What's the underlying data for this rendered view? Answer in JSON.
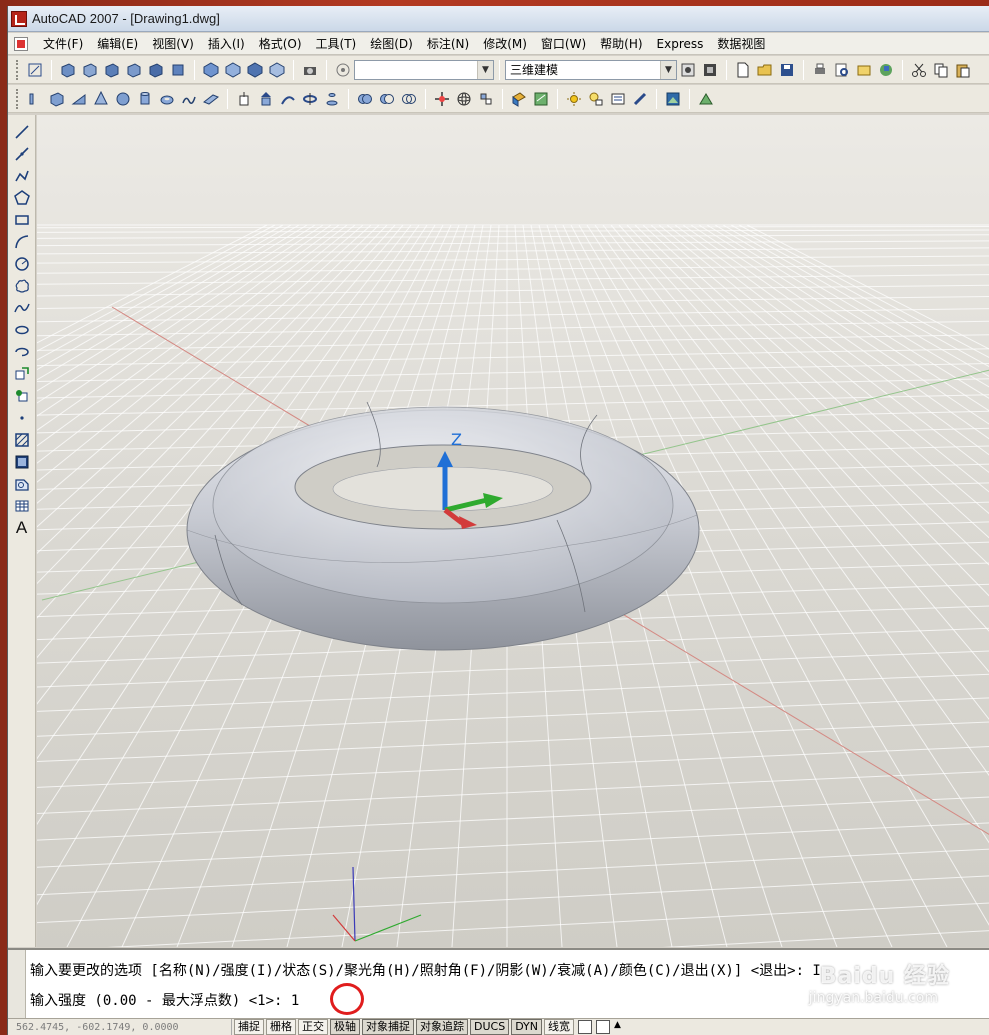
{
  "window": {
    "title": "AutoCAD 2007 - [Drawing1.dwg]"
  },
  "menubar": {
    "items": [
      "文件(F)",
      "编辑(E)",
      "视图(V)",
      "插入(I)",
      "格式(O)",
      "工具(T)",
      "绘图(D)",
      "标注(N)",
      "修改(M)",
      "窗口(W)",
      "帮助(H)",
      "Express",
      "数据视图"
    ]
  },
  "toolbar1": {
    "layer_combo_value": "",
    "workspace_combo_value": "三维建模"
  },
  "viewport": {
    "ucs_axis_label": "Z",
    "colors": {
      "x_axis": "#d23b3b",
      "y_axis": "#2faa2f",
      "z_axis": "#1f6fd6",
      "grid_line": "#ffffff",
      "torus": "#c9ccd4"
    }
  },
  "command": {
    "line1": "输入要更改的选项 [名称(N)/强度(I)/状态(S)/聚光角(H)/照射角(F)/阴影(W)/衰减(A)/颜色(C)/退出(X)] <退出>: I",
    "line2_prompt": "输入强度 (0.00 - 最大浮点数) <1>: ",
    "line2_input": "1",
    "watermark": "Baidu 经验",
    "watermark_sub": "jingyan.baidu.com"
  },
  "statusbar": {
    "coords": "562.4745,  -602.1749, 0.0000",
    "buttons": [
      "捕捉",
      "栅格",
      "正交",
      "极轴",
      "对象捕捉",
      "对象追踪",
      "DUCS",
      "DYN",
      "线宽"
    ]
  }
}
